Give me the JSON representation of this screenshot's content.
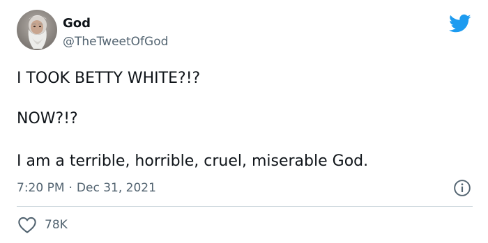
{
  "author": {
    "name": "God",
    "handle": "@TheTweetOfGod"
  },
  "tweet": {
    "lines": [
      "I TOOK BETTY WHITE?!?",
      "NOW?!?",
      "I am a terrible, horrible, cruel, miserable God."
    ],
    "time": "7:20 PM",
    "separator": "·",
    "date": "Dec 31, 2021"
  },
  "engagement": {
    "likes": "78K"
  },
  "icons": {
    "brand": "twitter-bird-icon",
    "info": "info-icon",
    "like": "heart-outline-icon"
  },
  "colors": {
    "brand": "#1d9bf0",
    "text": "#0f1419",
    "muted": "#536471",
    "divider": "#cfd9de"
  }
}
